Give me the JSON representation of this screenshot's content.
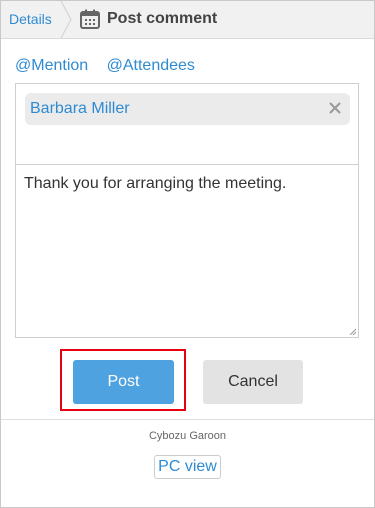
{
  "breadcrumb": {
    "parent": "Details",
    "title": "Post comment"
  },
  "mention": {
    "mention_label": "@Mention",
    "attendees_label": "@Attendees"
  },
  "recipient": {
    "name": "Barbara Miller"
  },
  "comment": {
    "text": "Thank you for arranging the meeting."
  },
  "actions": {
    "post_label": "Post",
    "cancel_label": "Cancel"
  },
  "footer": {
    "brand": "Cybozu Garoon",
    "pc_view_label": "PC view"
  },
  "colors": {
    "link": "#2e8bd3",
    "post_button": "#4ea2df",
    "highlight": "#e60012"
  },
  "icons": {
    "calendar": "calendar-icon",
    "remove": "close-icon"
  }
}
